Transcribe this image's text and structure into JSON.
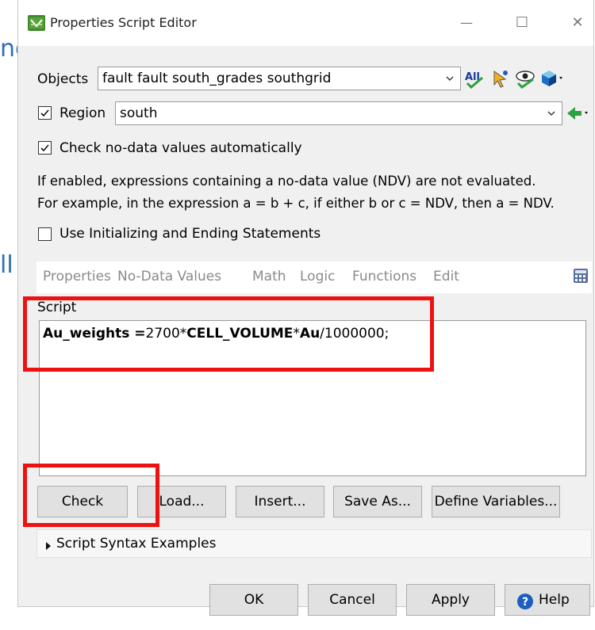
{
  "window": {
    "title": "Properties Script Editor",
    "minimize_glyph": "—",
    "maximize_glyph": "☐",
    "close_glyph": "✕"
  },
  "background_fragments": {
    "top_fragment": "ng",
    "mid_fragment": "ll"
  },
  "objects": {
    "label": "Objects",
    "value": "fault fault south_grades southgrid",
    "tools": [
      "all-select-icon",
      "pick-cursor-icon",
      "visibility-eye-icon",
      "cube-icon"
    ]
  },
  "region": {
    "label": "Region",
    "checked": true,
    "value": "south",
    "tools": [
      "green-arrow-icon"
    ]
  },
  "nodata_check": {
    "label": "Check no-data values automatically",
    "checked": true
  },
  "info": {
    "line1": "If enabled, expressions containing a no-data value (NDV) are not evaluated.",
    "line2": "For example, in the expression a = b + c, if either b or c = NDV, then a = NDV."
  },
  "init_check": {
    "label": "Use Initializing and Ending Statements",
    "checked": false
  },
  "tabs": [
    "Properties",
    "No-Data Values",
    "Math",
    "Logic",
    "Functions",
    "Edit"
  ],
  "script": {
    "label": "Script",
    "tokens": {
      "var": "Au_weights",
      "op": " =",
      "num": "2700*",
      "fn": "CELL_VOLUME",
      "mul": "*",
      "au": "Au",
      "tail": "/1000000;"
    }
  },
  "action_buttons": {
    "check": "Check",
    "load": "Load...",
    "insert": "Insert...",
    "save_as": "Save As...",
    "define": "Define Variables..."
  },
  "syntax_examples": "Script Syntax Examples",
  "dialog_buttons": {
    "ok": "OK",
    "cancel": "Cancel",
    "apply": "Apply",
    "help": "Help"
  },
  "colors": {
    "highlight": "#ee1111",
    "accent_green": "#3f8a2c",
    "help_blue": "#1d5fbf"
  }
}
